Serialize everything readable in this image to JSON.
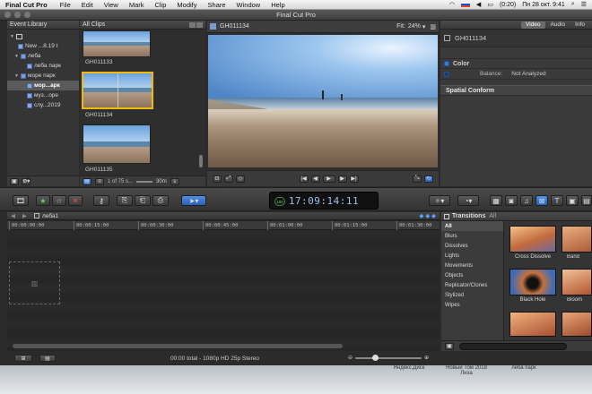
{
  "menubar": {
    "app": "Final Cut Pro",
    "items": [
      "File",
      "Edit",
      "View",
      "Mark",
      "Clip",
      "Modify",
      "Share",
      "Window",
      "Help"
    ],
    "battery": "(0:20)",
    "clock": "Пн 28 окт.  9:41"
  },
  "window": {
    "title": "Final Cut Pro"
  },
  "event_library": {
    "title": "Event Library",
    "items": [
      {
        "label": "New ...8.19 t"
      },
      {
        "label": "леба"
      },
      {
        "label": "леба парк"
      },
      {
        "label": "море парк"
      },
      {
        "label": "мор...арк"
      },
      {
        "label": "муз...оре"
      },
      {
        "label": "слу...2019"
      }
    ]
  },
  "browser": {
    "filter": "All Clips",
    "clips": [
      {
        "name": "GH011133"
      },
      {
        "name": "GH011134"
      },
      {
        "name": "GH011135"
      }
    ],
    "count": "1 of 75 s...",
    "duration": "30m"
  },
  "viewer": {
    "clip": "GH011134",
    "fit_label": "Fit:",
    "zoom": "24%"
  },
  "inspector": {
    "tabs": [
      "Video",
      "Audio",
      "Info"
    ],
    "active_tab": "Video",
    "clip": "GH011134",
    "section_color": "Color",
    "balance_label": "Balance:",
    "balance_value": "Not Analyzed",
    "section_spatial": "Spatial Conform"
  },
  "toolbar": {
    "timecode": "17:09:14:11",
    "tc_badge": "100"
  },
  "timeline": {
    "project": "леба1",
    "ticks": [
      "00:00:00:00",
      "00:00:15:00",
      "00:00:30:00",
      "00:00:45:00",
      "00:01:00:00",
      "00:01:15:00",
      "00:01:30:00"
    ]
  },
  "transitions": {
    "title": "Transitions",
    "filter": "All",
    "categories": [
      "All",
      "Blurs",
      "Dissolves",
      "Lights",
      "Movements",
      "Objects",
      "Replicator/Clones",
      "Stylized",
      "Wipes"
    ],
    "items": [
      {
        "name": "Cross Dissolve"
      },
      {
        "name": "Band"
      },
      {
        "name": "Black Hole"
      },
      {
        "name": "Bloom"
      }
    ]
  },
  "status": {
    "text": "00:00 total - 1080p HD 25p Stereo"
  },
  "desktop": {
    "labels": [
      "Яндекс.Диск",
      "Новый Том 2018 Лиза",
      "леба парк"
    ]
  }
}
